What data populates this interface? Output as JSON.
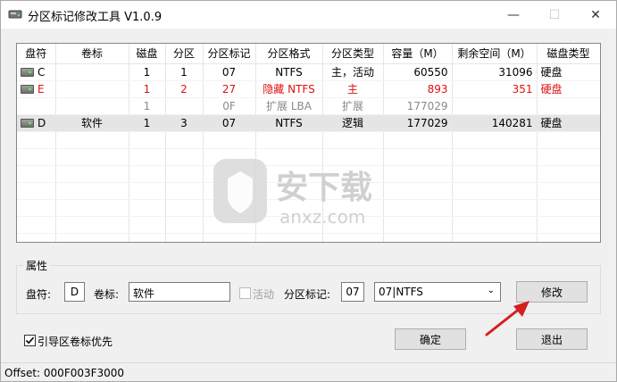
{
  "window": {
    "title": "分区标记修改工具 V1.0.9",
    "min": "—",
    "max": "☐",
    "close": "✕"
  },
  "table": {
    "headers": [
      "盘符",
      "卷标",
      "磁盘",
      "分区",
      "分区标记",
      "分区格式",
      "分区类型",
      "容量（M）",
      "剩余空间（M）",
      "磁盘类型"
    ],
    "rows": [
      {
        "drive": "C",
        "label": "",
        "disk": "1",
        "part": "1",
        "mark": "07",
        "fmt": "NTFS",
        "type": "主，活动",
        "cap": "60550",
        "free": "31096",
        "dtype": "硬盘",
        "style": ""
      },
      {
        "drive": "E",
        "label": "",
        "disk": "1",
        "part": "2",
        "mark": "27",
        "fmt": "隐藏 NTFS",
        "type": "主",
        "cap": "893",
        "free": "351",
        "dtype": "硬盘",
        "style": "red"
      },
      {
        "drive": "",
        "label": "",
        "disk": "1",
        "part": "",
        "mark": "0F",
        "fmt": "扩展 LBA",
        "type": "扩展",
        "cap": "177029",
        "free": "",
        "dtype": "",
        "style": "grey"
      },
      {
        "drive": "D",
        "label": "软件",
        "disk": "1",
        "part": "3",
        "mark": "07",
        "fmt": "NTFS",
        "type": "逻辑",
        "cap": "177029",
        "free": "140281",
        "dtype": "硬盘",
        "style": "sel"
      }
    ]
  },
  "watermark": {
    "text": "安下载",
    "sub": "anxz.com"
  },
  "props": {
    "group": "属性",
    "drive_label": "盘符:",
    "drive_value": "D",
    "volume_label": "卷标:",
    "volume_value": "软件",
    "active_label": "活动",
    "mark_label": "分区标记:",
    "mark_value": "07",
    "fs_select": "07|NTFS",
    "modify_button": "修改"
  },
  "boot_check_label": "引导区卷标优先",
  "ok_button": "确定",
  "exit_button": "退出",
  "status": "Offset: 000F003F3000",
  "colors": {
    "red_row": "#e01010",
    "grey_row": "#8a8a8a",
    "selected_row": "#e5e5e5",
    "arrow": "#d42020"
  }
}
